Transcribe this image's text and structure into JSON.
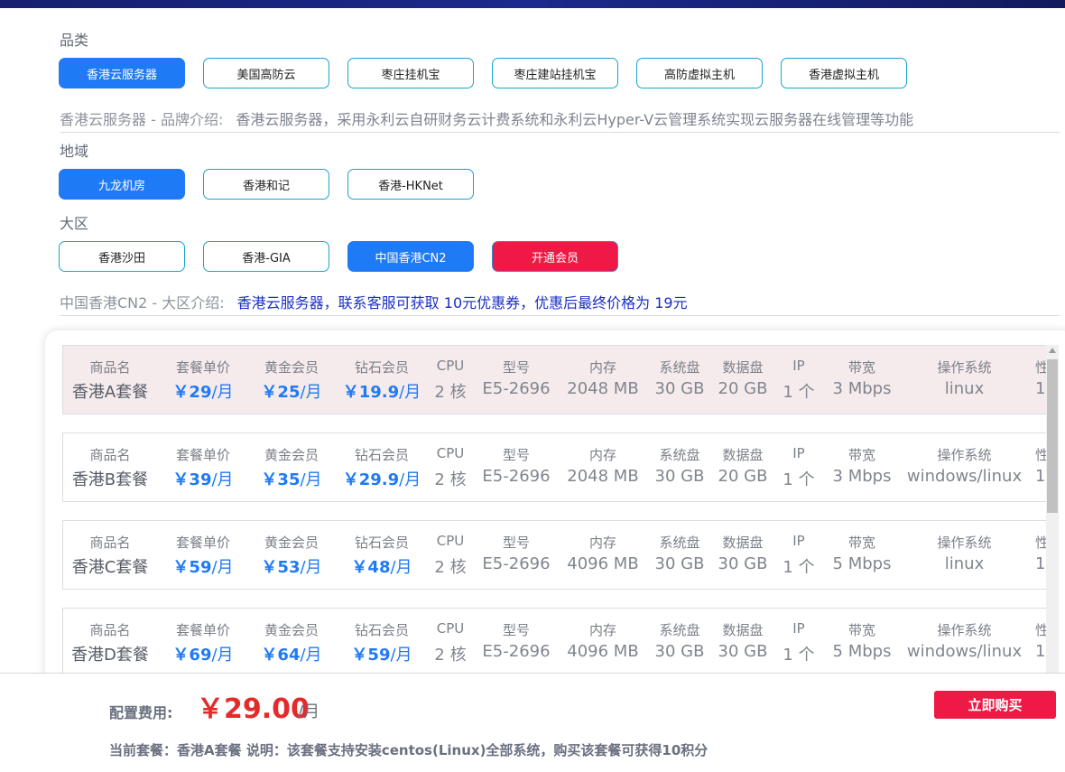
{
  "category": {
    "label": "品类",
    "options": [
      "香港云服务器",
      "美国高防云",
      "枣庄挂机宝",
      "枣庄建站挂机宝",
      "高防虚拟主机",
      "香港虚拟主机"
    ],
    "intro_prefix": "香港云服务器 - 品牌介绍:",
    "intro_text": "香港云服务器，采用永利云自研财务云计费系统和永利云Hyper-V云管理系统实现云服务器在线管理等功能"
  },
  "region": {
    "label": "地域",
    "options": [
      "九龙机房",
      "香港和记",
      "香港-HKNet"
    ]
  },
  "zone": {
    "label": "大区",
    "options": [
      "香港沙田",
      "香港-GIA",
      "中国香港CN2",
      "开通会员"
    ],
    "intro_prefix": "中国香港CN2 - 大区介绍:",
    "intro_text": "香港云服务器，联系客服可获取 10元优惠券，优惠后最终价格为 19元"
  },
  "table_headers": [
    "商品名",
    "套餐单价",
    "黄金会员",
    "钻石会员",
    "CPU",
    "型号",
    "内存",
    "系统盘",
    "数据盘",
    "IP",
    "带宽",
    "操作系统",
    "性"
  ],
  "packages": [
    {
      "name": "香港A套餐",
      "price": "￥29",
      "gold": "￥25",
      "diamond": "￥19.9",
      "cpu": "2 核",
      "model": "E5-2696",
      "ram": "2048 MB",
      "sys_disk": "30 GB",
      "data_disk": "20 GB",
      "ip": "1 个",
      "bandwidth": "3 Mbps",
      "os": "linux",
      "extra": "1"
    },
    {
      "name": "香港B套餐",
      "price": "￥39",
      "gold": "￥35",
      "diamond": "￥29.9",
      "cpu": "2 核",
      "model": "E5-2696",
      "ram": "2048 MB",
      "sys_disk": "30 GB",
      "data_disk": "20 GB",
      "ip": "1 个",
      "bandwidth": "3 Mbps",
      "os": "windows/linux",
      "extra": "1"
    },
    {
      "name": "香港C套餐",
      "price": "￥59",
      "gold": "￥53",
      "diamond": "￥48",
      "cpu": "2 核",
      "model": "E5-2696",
      "ram": "4096 MB",
      "sys_disk": "30 GB",
      "data_disk": "30 GB",
      "ip": "1 个",
      "bandwidth": "5 Mbps",
      "os": "linux",
      "extra": "1"
    },
    {
      "name": "香港D套餐",
      "price": "￥69",
      "gold": "￥64",
      "diamond": "￥59",
      "cpu": "2 核",
      "model": "E5-2696",
      "ram": "4096 MB",
      "sys_disk": "30 GB",
      "data_disk": "30 GB",
      "ip": "1 个",
      "bandwidth": "5 Mbps",
      "os": "windows/linux",
      "extra": "1"
    }
  ],
  "price_unit": "/月",
  "footer": {
    "cost_label": "配置费用:",
    "cost_value": "￥29.00",
    "cost_unit": "/月",
    "buy_label": "立即购买",
    "note": "当前套餐：香港A套餐 说明：该套餐支持安装centos(Linux)全部系统，购买该套餐可获得10积分"
  },
  "colors": {
    "accent": "#1f7af5",
    "member": "#ee1a45",
    "price": "#e32b2b",
    "topbar": "#1b2a8c"
  }
}
